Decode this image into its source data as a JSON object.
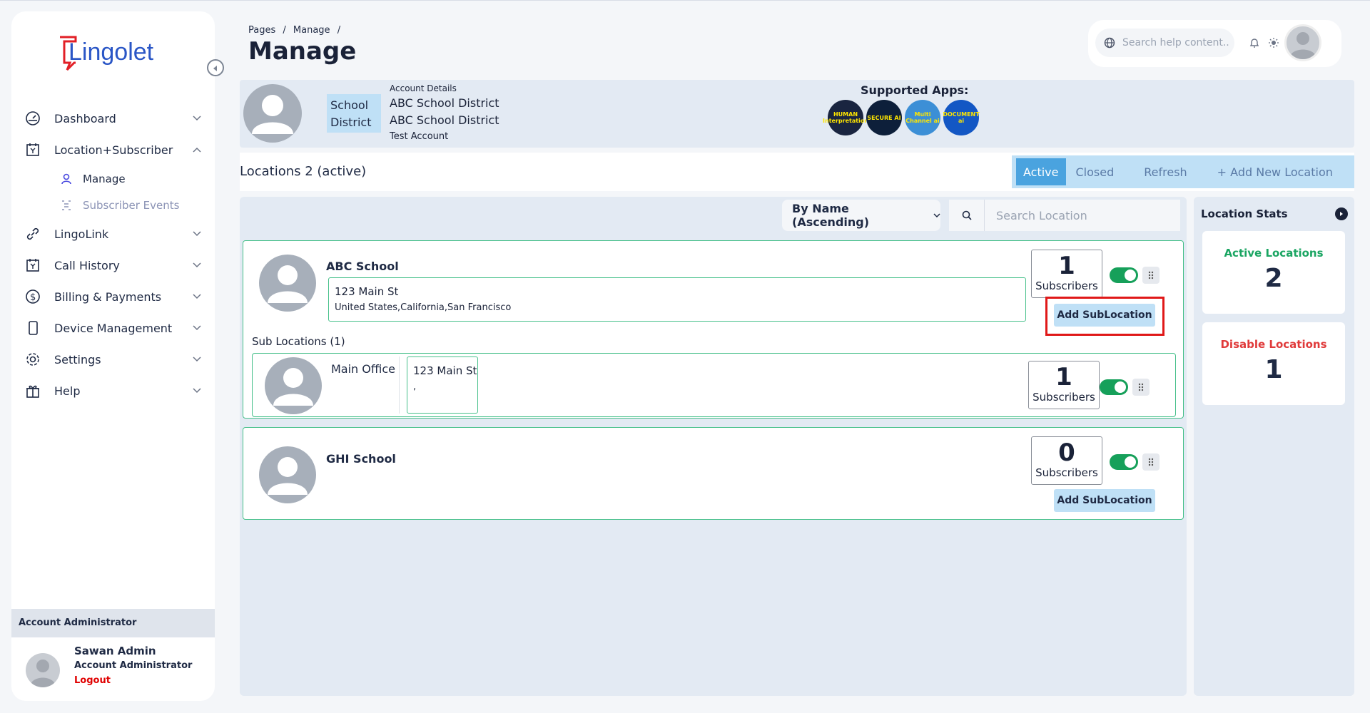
{
  "brand": {
    "logo_text": "Lingolet"
  },
  "sidebar": {
    "items": [
      {
        "label": "Dashboard",
        "icon": "gauge-icon"
      },
      {
        "label": "Location+Subscriber",
        "icon": "calendar-icon"
      },
      {
        "label": "LingoLink",
        "icon": "link-icon"
      },
      {
        "label": "Call History",
        "icon": "calendar-icon"
      },
      {
        "label": "Billing & Payments",
        "icon": "dollar-icon"
      },
      {
        "label": "Device Management",
        "icon": "phone-icon"
      },
      {
        "label": "Settings",
        "icon": "gear-icon"
      },
      {
        "label": "Help",
        "icon": "gift-icon"
      }
    ],
    "subitems": [
      {
        "label": "Manage"
      },
      {
        "label": "Subscriber Events"
      }
    ],
    "account_header": "Account Administrator",
    "profile": {
      "name": "Sawan Admin",
      "role": "Account Administrator",
      "logout": "Logout"
    }
  },
  "header": {
    "breadcrumb": [
      "Pages",
      "/",
      "Manage",
      "/"
    ],
    "title": "Manage",
    "search_placeholder": "Search help content.."
  },
  "account": {
    "type_line1": "School",
    "type_line2": "District",
    "details_label": "Account Details",
    "name1": "ABC School District",
    "name2": "ABC School District",
    "note": "Test Account",
    "apps_label": "Supported Apps:",
    "apps": [
      {
        "label": "HUMAN Interpretation",
        "color": "#1a2540"
      },
      {
        "label": "SECURE AI",
        "color": "#0d1f3a"
      },
      {
        "label": "Multi Channel ai",
        "color": "#3c8fd6"
      },
      {
        "label": "DOCUMENT ai",
        "color": "#1357c4"
      }
    ]
  },
  "locations": {
    "title": "Locations 2 (active)",
    "filters": [
      "Active",
      "Closed",
      "Refresh",
      "+ Add New Location"
    ],
    "sort_label": "By Name (Ascending)",
    "search_placeholder": "Search Location",
    "cards": [
      {
        "name": "ABC School",
        "address1": "123 Main St",
        "address2": "United States,California,San Francisco",
        "subscribers": "1",
        "subscribers_label": "Subscribers",
        "add_sub_label": "Add SubLocation",
        "sub_header": "Sub Locations (1)",
        "sublocations": [
          {
            "name": "Main Office",
            "address1": "123 Main St",
            "address2": ",",
            "subscribers": "1",
            "subscribers_label": "Subscribers"
          }
        ]
      },
      {
        "name": "GHI School",
        "subscribers": "0",
        "subscribers_label": "Subscribers",
        "add_sub_label": "Add SubLocation"
      }
    ]
  },
  "stats": {
    "title": "Location Stats",
    "active_label": "Active Locations",
    "active_value": "2",
    "active_color": "#1aa562",
    "disable_label": "Disable Locations",
    "disable_value": "1",
    "disable_color": "#e03a3a"
  }
}
